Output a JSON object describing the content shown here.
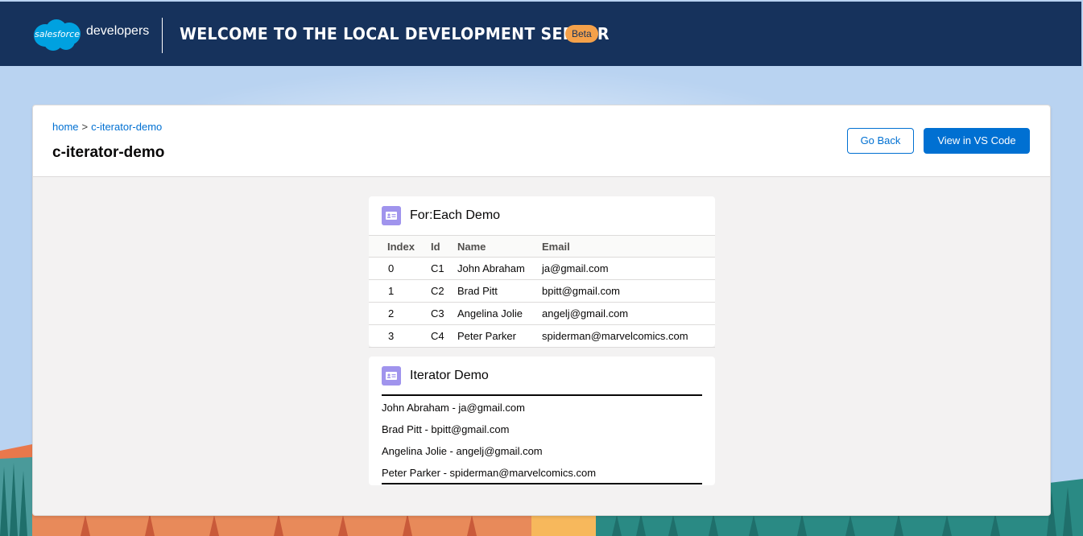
{
  "header": {
    "logo_text": "salesforce",
    "brand": "developers",
    "title": "Welcome to the Local Development Server",
    "badge": "Beta"
  },
  "breadcrumb": {
    "home": "home",
    "separator": ">",
    "current": "c-iterator-demo"
  },
  "page": {
    "title": "c-iterator-demo",
    "go_back_label": "Go Back",
    "vscode_label": "View in VS Code"
  },
  "foreach": {
    "title": "For:Each Demo",
    "columns": [
      "Index",
      "Id",
      "Name",
      "Email"
    ],
    "rows": [
      {
        "index": "0",
        "id": "C1",
        "name": "John Abraham",
        "email": "ja@gmail.com"
      },
      {
        "index": "1",
        "id": "C2",
        "name": "Brad Pitt",
        "email": "bpitt@gmail.com"
      },
      {
        "index": "2",
        "id": "C3",
        "name": "Angelina Jolie",
        "email": "angelj@gmail.com"
      },
      {
        "index": "3",
        "id": "C4",
        "name": "Peter Parker",
        "email": "spiderman@marvelcomics.com"
      }
    ]
  },
  "iterator": {
    "title": "Iterator Demo",
    "items": [
      "John Abraham - ja@gmail.com",
      "Brad Pitt - bpitt@gmail.com",
      "Angelina Jolie - angelj@gmail.com",
      "Peter Parker - spiderman@marvelcomics.com"
    ]
  },
  "colors": {
    "header_bg": "#16325c",
    "brand_blue": "#0070d2",
    "badge": "#f4a14a",
    "icon_purple": "#a094ed"
  }
}
